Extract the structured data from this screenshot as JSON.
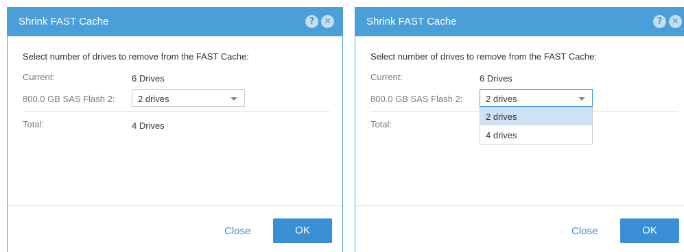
{
  "dialog_left": {
    "title": "Shrink FAST Cache",
    "help_glyph": "?",
    "close_glyph": "✕",
    "subtitle": "Select number of drives to remove from the FAST Cache:",
    "current_label": "Current:",
    "current_value": "6 Drives",
    "drive_label": "800.0 GB SAS Flash 2:",
    "drive_selected": "2 drives",
    "total_label": "Total:",
    "total_value": "4 Drives",
    "close_label": "Close",
    "ok_label": "OK"
  },
  "dialog_right": {
    "title": "Shrink FAST Cache",
    "help_glyph": "?",
    "close_glyph": "✕",
    "subtitle": "Select number of drives to remove from the FAST Cache:",
    "current_label": "Current:",
    "current_value": "6 Drives",
    "drive_label": "800.0 GB SAS Flash 2:",
    "drive_selected": "2 drives",
    "dropdown_options": [
      "2 drives",
      "4 drives"
    ],
    "total_label": "Total:",
    "close_label": "Close",
    "ok_label": "OK"
  },
  "colors": {
    "title_bar": "#4a9fd9",
    "primary_button": "#3a8ed4",
    "selected_option": "#cfe2f3"
  },
  "icons": [
    "help-icon",
    "close-icon",
    "chevron-down-icon"
  ]
}
